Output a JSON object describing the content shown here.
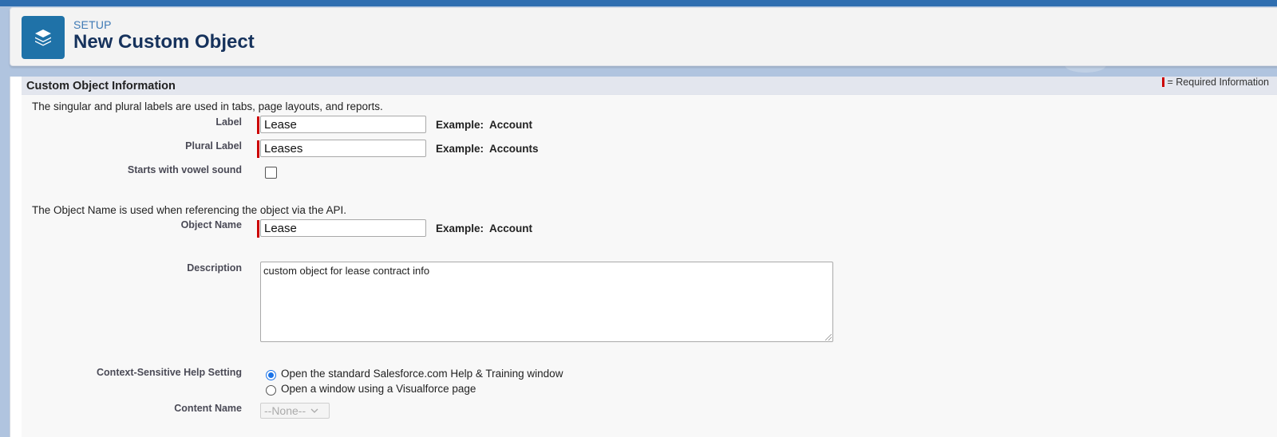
{
  "header": {
    "eyebrow": "SETUP",
    "title": "New Custom Object",
    "icon": "layers-icon"
  },
  "section": {
    "title": "Custom Object Information",
    "required_info": "= Required Information"
  },
  "intro": {
    "labels_help": "The singular and plural labels are used in tabs, page layouts, and reports.",
    "api_help": "The Object Name is used when referencing the object via the API."
  },
  "fields": {
    "label": {
      "label": "Label",
      "value": "Lease",
      "example_prefix": "Example:",
      "example_value": "Account"
    },
    "plural_label": {
      "label": "Plural Label",
      "value": "Leases",
      "example_prefix": "Example:",
      "example_value": "Accounts"
    },
    "vowel": {
      "label": "Starts with vowel sound",
      "checked": false
    },
    "object_name": {
      "label": "Object Name",
      "value": "Lease",
      "example_prefix": "Example:",
      "example_value": "Account"
    },
    "description": {
      "label": "Description",
      "value": "custom object for lease contract info"
    },
    "help_setting": {
      "label": "Context-Sensitive Help Setting",
      "option_standard": "Open the standard Salesforce.com Help & Training window",
      "option_visualforce": "Open a window using a Visualforce page",
      "selected": "standard"
    },
    "content_name": {
      "label": "Content Name",
      "value": "--None--"
    }
  },
  "colors": {
    "required": "#cc0000",
    "brand_icon": "#1f72a8",
    "radio_selected": "#1a73e8"
  }
}
